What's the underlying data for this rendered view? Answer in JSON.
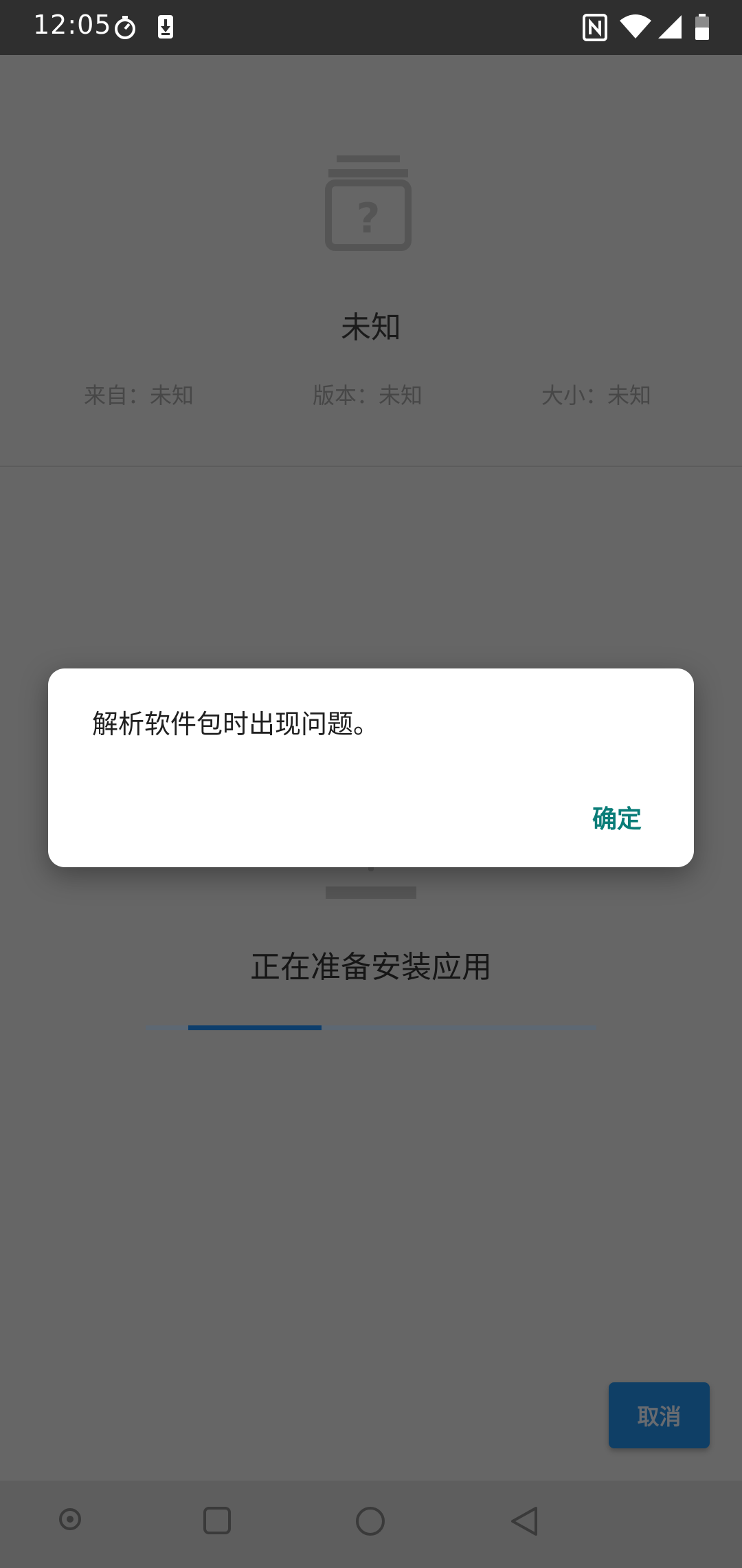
{
  "status_bar": {
    "time": "12:05",
    "icons": [
      "timer-icon",
      "download-icon",
      "nfc-icon",
      "wifi-icon",
      "signal-icon",
      "battery-icon"
    ]
  },
  "app_info": {
    "icon": "unknown-package-icon",
    "name": "未知",
    "source": "来自：未知",
    "version": "版本：未知",
    "size": "大小：未知"
  },
  "progress": {
    "label": "正在准备安装应用",
    "indeterminate": true
  },
  "cancel_label": "取消",
  "dialog": {
    "message": "解析软件包时出现问题。",
    "ok_label": "确定",
    "ok_color": "#0a7d78"
  },
  "nav_bar": {
    "icons": [
      "assistant-icon",
      "recents-icon",
      "home-icon",
      "back-icon"
    ]
  }
}
